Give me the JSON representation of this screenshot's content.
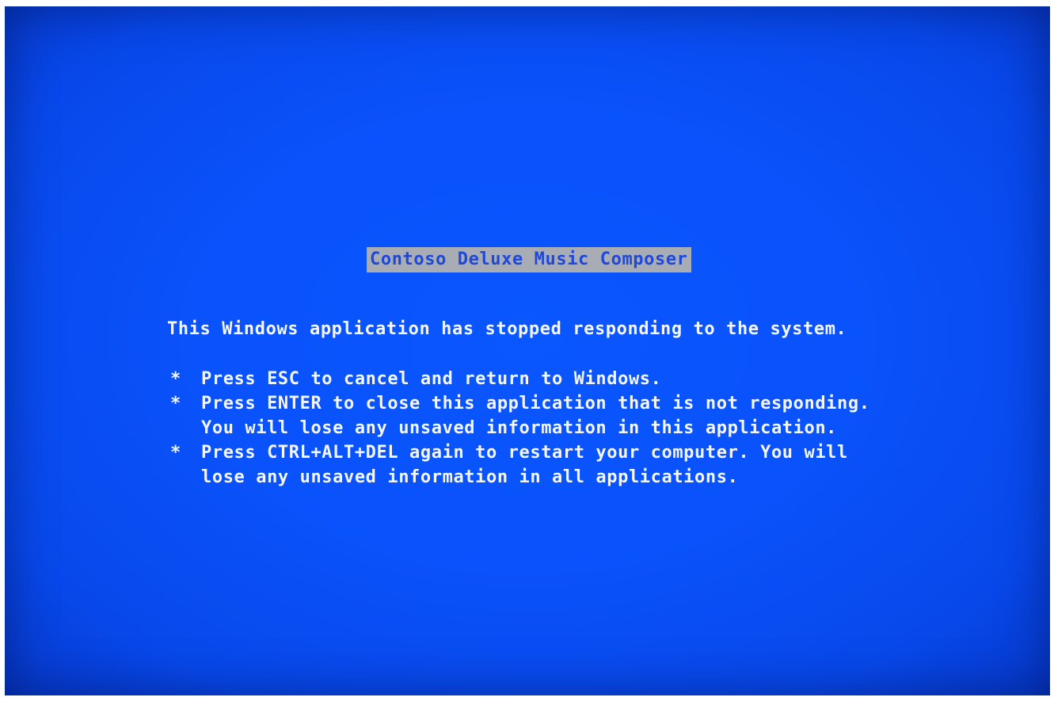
{
  "screen": {
    "background_color": "#0a52fb",
    "text_color": "#f4f6ff",
    "title_bar_color": "#a8acb4",
    "title_text_color": "#1f48d8"
  },
  "title": "Contoso Deluxe Music Composer",
  "message": "This Windows application has stopped responding to the system.",
  "bullet_marker": "*",
  "bullets": [
    {
      "lines": [
        "Press ESC to cancel and return to Windows."
      ]
    },
    {
      "lines": [
        "Press ENTER to close this application that is not responding.",
        "You will lose any unsaved information in this application."
      ]
    },
    {
      "lines": [
        "Press CTRL+ALT+DEL again to restart your computer. You will",
        "lose any unsaved information in all applications."
      ]
    }
  ]
}
